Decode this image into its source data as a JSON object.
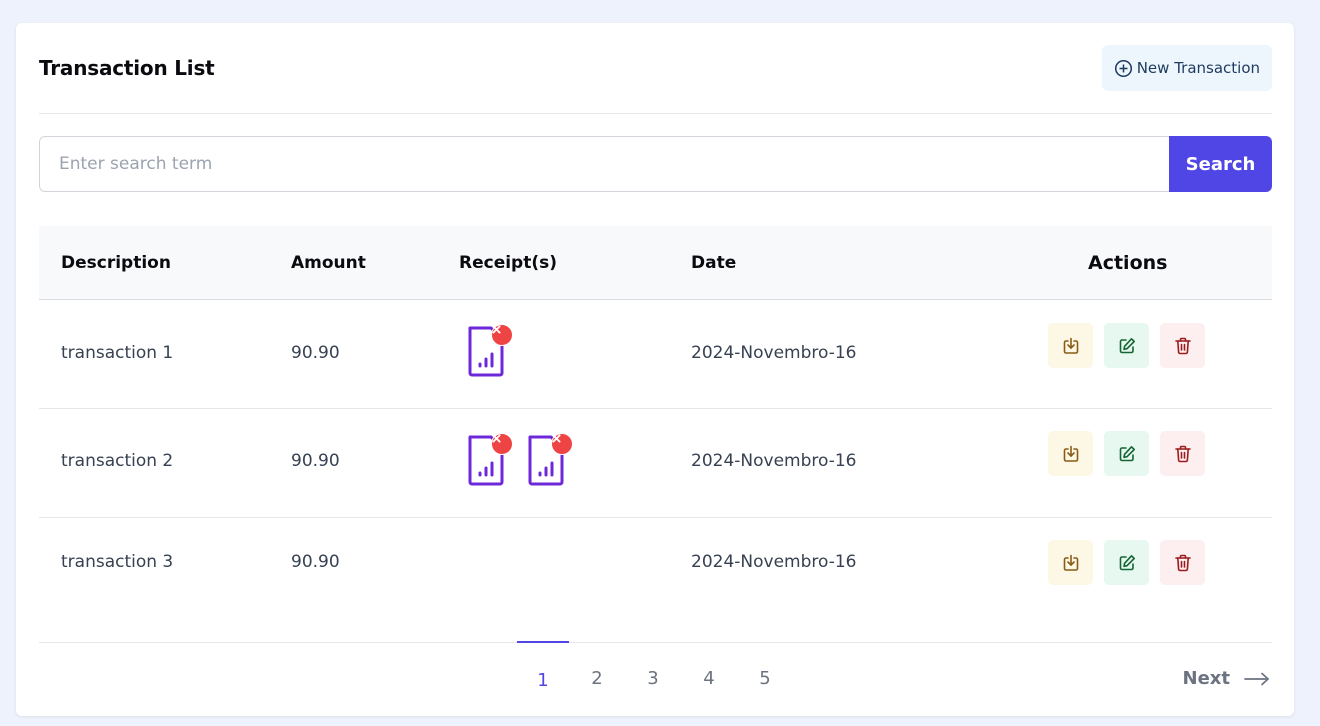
{
  "header": {
    "title": "Transaction List",
    "new_button_label": "New Transaction",
    "new_button_icon": "plus-circle-icon"
  },
  "search": {
    "placeholder": "Enter search term",
    "value": "",
    "button_label": "Search"
  },
  "table": {
    "columns": [
      "Description",
      "Amount",
      "Receipt(s)",
      "Date",
      "Actions"
    ],
    "rows": [
      {
        "description": "transaction 1",
        "amount": "90.90",
        "receipt_count": 1,
        "date": "2024-Novembro-16"
      },
      {
        "description": "transaction 2",
        "amount": "90.90",
        "receipt_count": 2,
        "date": "2024-Novembro-16"
      },
      {
        "description": "transaction 3",
        "amount": "90.90",
        "receipt_count": 0,
        "date": "2024-Novembro-16"
      }
    ],
    "row_actions": [
      "download-icon",
      "edit-icon",
      "trash-icon"
    ]
  },
  "pagination": {
    "pages": [
      "1",
      "2",
      "3",
      "4",
      "5"
    ],
    "current": "1",
    "next_label": "Next",
    "next_icon": "arrow-right-icon"
  },
  "colors": {
    "primary": "#4f46e5",
    "receipt_icon": "#6d28d9",
    "remove_badge": "#ef4444",
    "download_bg": "#fdf8e6",
    "edit_bg": "#e6f8ef",
    "delete_bg": "#fdeef0",
    "background": "#eef2fd"
  }
}
